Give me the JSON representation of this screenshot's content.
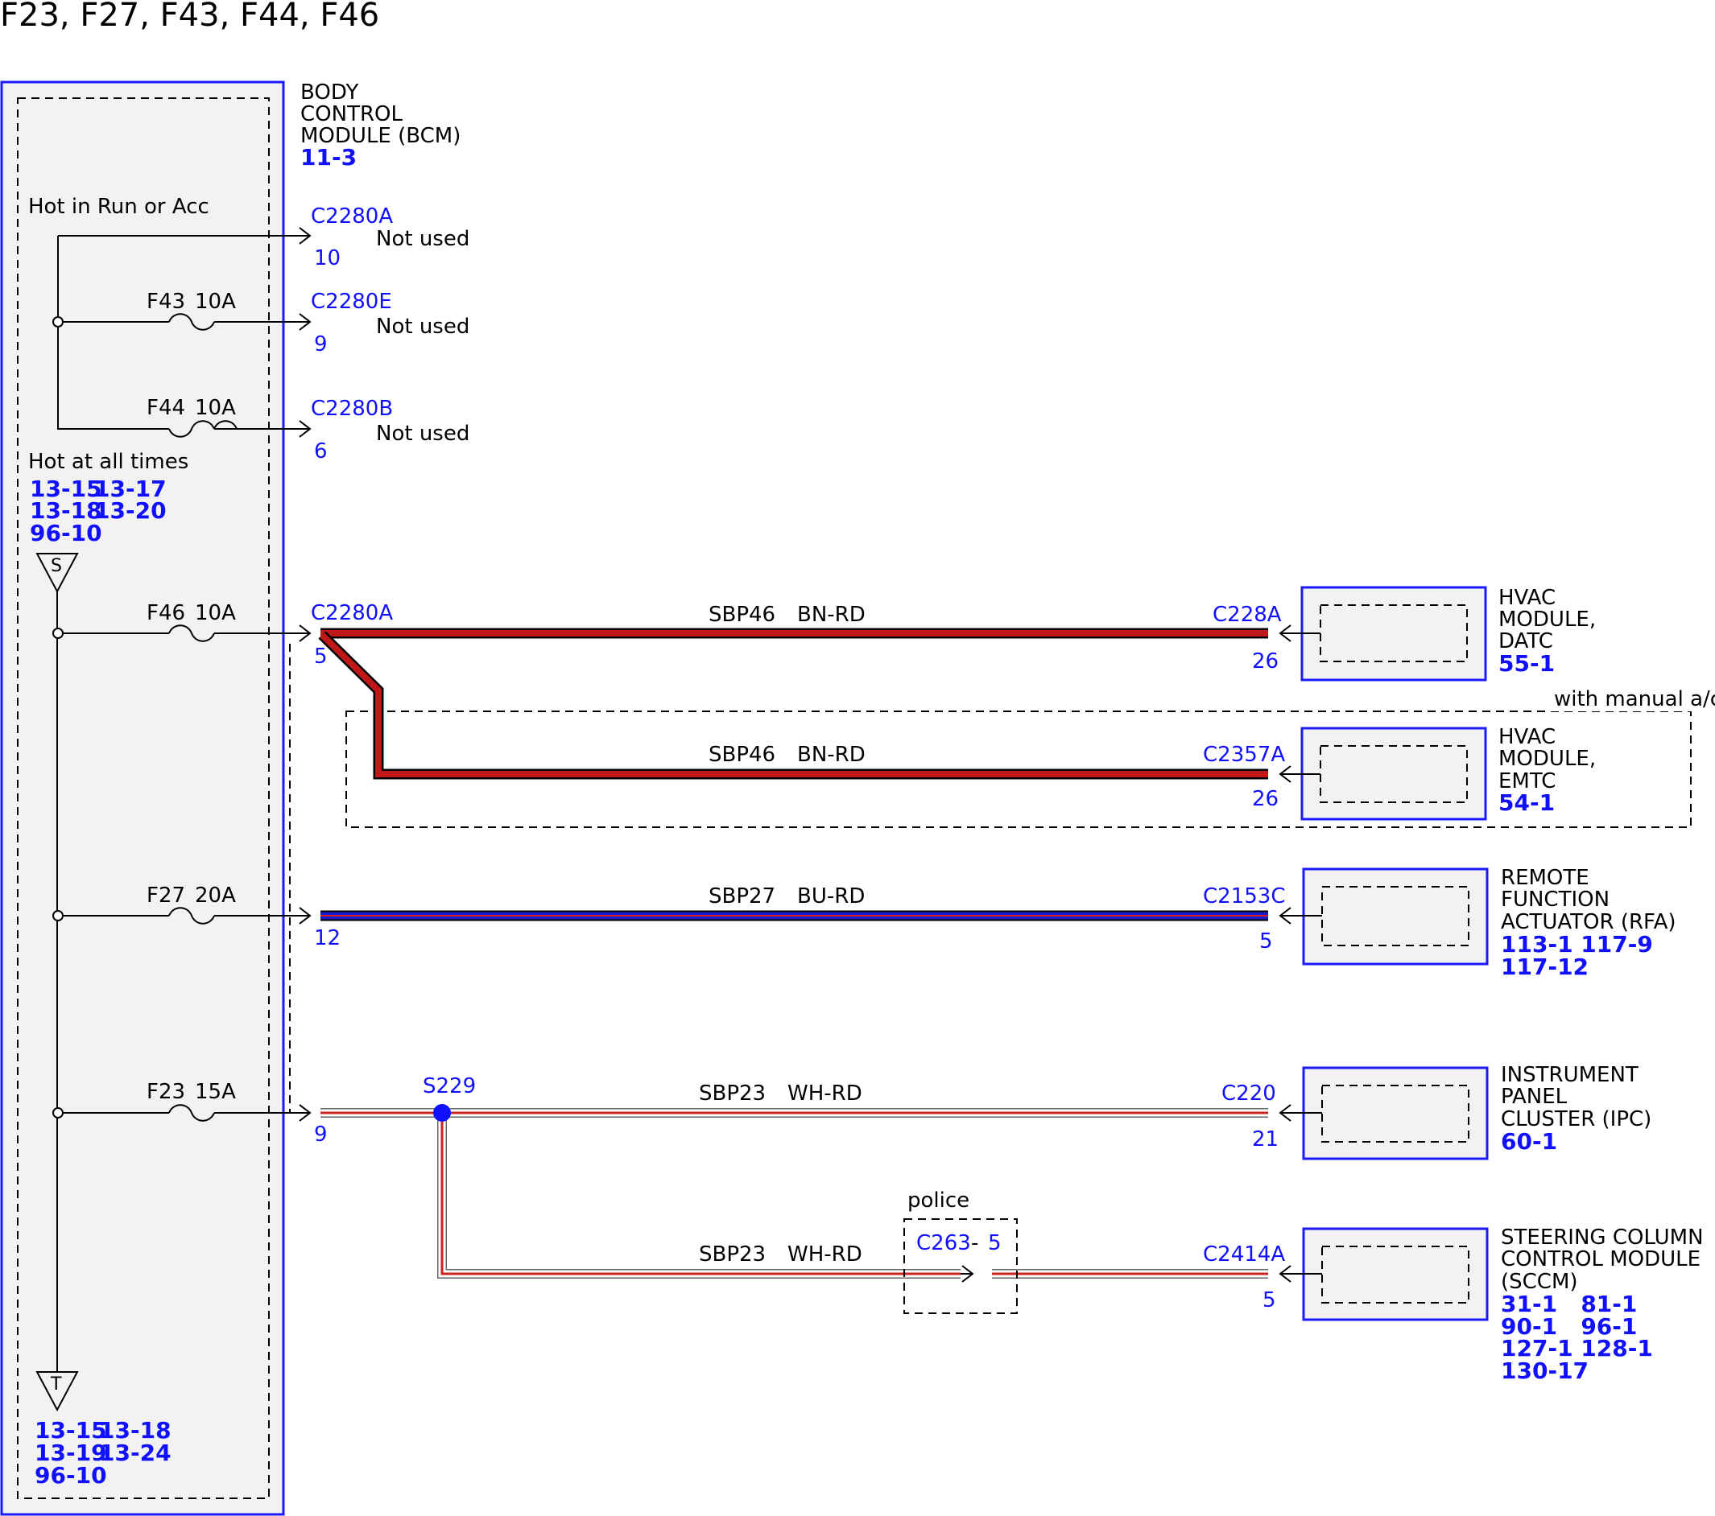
{
  "title": "F23, F27, F43, F44, F46",
  "bcm": {
    "name_lines": [
      "BODY",
      "CONTROL",
      "MODULE (BCM)"
    ],
    "ref": "11-3"
  },
  "bcm_internal": {
    "hot_run_label": "Hot in Run or Acc",
    "hot_all_label": "Hot at all times",
    "hot_all_refs": [
      "13-15",
      "13-17",
      "13-18",
      "13-20",
      "96-10"
    ],
    "symbol_s": "S",
    "symbol_t": "T",
    "t_refs": [
      "13-15",
      "13-18",
      "13-19",
      "13-24",
      "96-10"
    ]
  },
  "fuses": {
    "f43": {
      "name": "F43",
      "rating": "10A"
    },
    "f44": {
      "name": "F44",
      "rating": "10A"
    },
    "f46": {
      "name": "F46",
      "rating": "10A"
    },
    "f27": {
      "name": "F27",
      "rating": "20A"
    },
    "f23": {
      "name": "F23",
      "rating": "15A"
    }
  },
  "unused_outputs": [
    {
      "connector": "C2280A",
      "pin": "10",
      "note": "Not used"
    },
    {
      "connector": "C2280E",
      "pin": "9",
      "note": "Not used"
    },
    {
      "connector": "C2280B",
      "pin": "6",
      "note": "Not used"
    }
  ],
  "circuits": {
    "sbp46": {
      "bcm_connector": "C2280A",
      "bcm_pin": "5",
      "circuit": "SBP46",
      "color_code": "BN-RD",
      "wire_color": "#c01818"
    },
    "sbp27": {
      "bcm_pin": "12",
      "circuit": "SBP27",
      "color_code": "BU-RD",
      "wire_color": "#1a1acc"
    },
    "sbp23": {
      "bcm_pin": "9",
      "circuit": "SBP23",
      "color_code": "WH-RD",
      "wire_color": "#d02020",
      "splice": "S229"
    }
  },
  "option_labels": {
    "manual_ac": "with manual a/c",
    "police": "police"
  },
  "inline_connector": {
    "name": "C263",
    "sep": "-",
    "pin": "5"
  },
  "modules": [
    {
      "connector": "C228A",
      "pin": "26",
      "circuit": "SBP46",
      "color_code": "BN-RD",
      "lines": [
        "HVAC",
        "MODULE,",
        "DATC"
      ],
      "refs": [
        "55-1"
      ]
    },
    {
      "connector": "C2357A",
      "pin": "26",
      "circuit": "SBP46",
      "color_code": "BN-RD",
      "lines": [
        "HVAC",
        "MODULE,",
        "EMTC"
      ],
      "refs": [
        "54-1"
      ]
    },
    {
      "connector": "C2153C",
      "pin": "5",
      "circuit": "SBP27",
      "color_code": "BU-RD",
      "lines": [
        "REMOTE",
        "FUNCTION",
        "ACTUATOR (RFA)"
      ],
      "refs": [
        "113-1 117-9",
        "117-12"
      ]
    },
    {
      "connector": "C220",
      "pin": "21",
      "circuit": "SBP23",
      "color_code": "WH-RD",
      "lines": [
        "INSTRUMENT",
        "PANEL",
        "CLUSTER (IPC)"
      ],
      "refs": [
        "60-1"
      ]
    },
    {
      "connector": "C2414A",
      "pin": "5",
      "circuit": "SBP23",
      "color_code": "WH-RD",
      "lines": [
        "STEERING COLUMN",
        "CONTROL MODULE",
        "(SCCM)"
      ],
      "refs": [
        "31-1   81-1",
        "90-1   96-1",
        "127-1 128-1",
        "130-17"
      ]
    }
  ]
}
